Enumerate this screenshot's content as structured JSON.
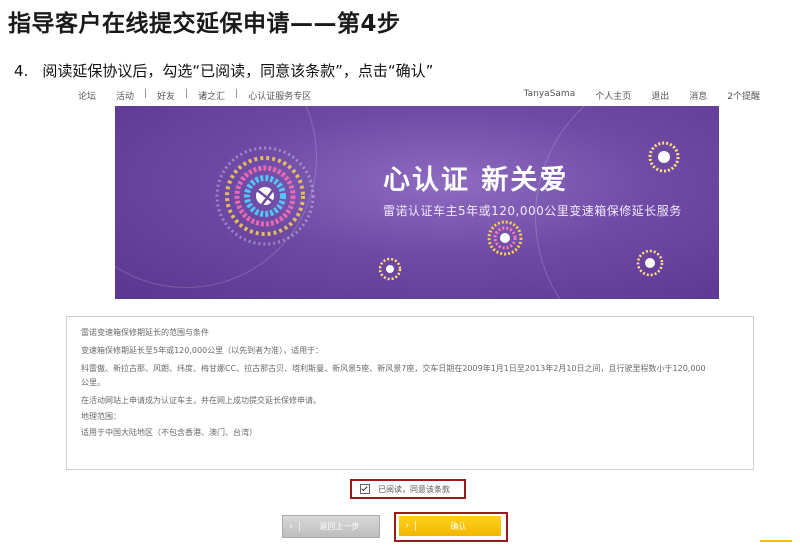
{
  "page": {
    "title": "指导客户在线提交延保申请——第4步",
    "step_number": "4.",
    "step_text": "阅读延保协议后，勾选“已阅读，同意该条款”，点击“确认”"
  },
  "nav": {
    "left_items": [
      "论坛",
      "活动",
      "好友",
      "诸之汇",
      "心认证服务专区"
    ],
    "right_items": [
      "TanyaSama",
      "个人主页",
      "退出",
      "消息",
      "2个提醒"
    ]
  },
  "banner": {
    "headline": "心认证  新关爱",
    "subtitle": "雷诺认证车主5年或120,000公里变速箱保修延长服务",
    "colors": {
      "bg_dark": "#5a3690",
      "bg_light": "#8e6cc0"
    }
  },
  "terms": {
    "lines": [
      "雷诺变速箱保修期延长的范围与条件",
      "变速箱保修期延长至5年或120,000公里（以先到者为准），适用于：",
      "科雷傲、新拉古那、风朗、纬度、梅甘娜CC、拉古那古贝、塔利斯曼、新风景5座、新风景7座，交车日期在2009年1月1日至2013年2月10日之间，且行驶里程数小于120,000",
      "公里。",
      "在活动网站上申请成为认证车主，并在网上成功提交延长保修申请。",
      "地理范围：",
      "适用于中国大陆地区（不包含香港、澳门、台湾）"
    ]
  },
  "agreement": {
    "label": "已阅读，同意该条款",
    "checked": true
  },
  "buttons": {
    "back": "返回上一步",
    "confirm": "确认",
    "arrow": "›"
  },
  "colors": {
    "highlight_red": "#9b1b1b",
    "confirm_yellow": "#f2b600"
  }
}
